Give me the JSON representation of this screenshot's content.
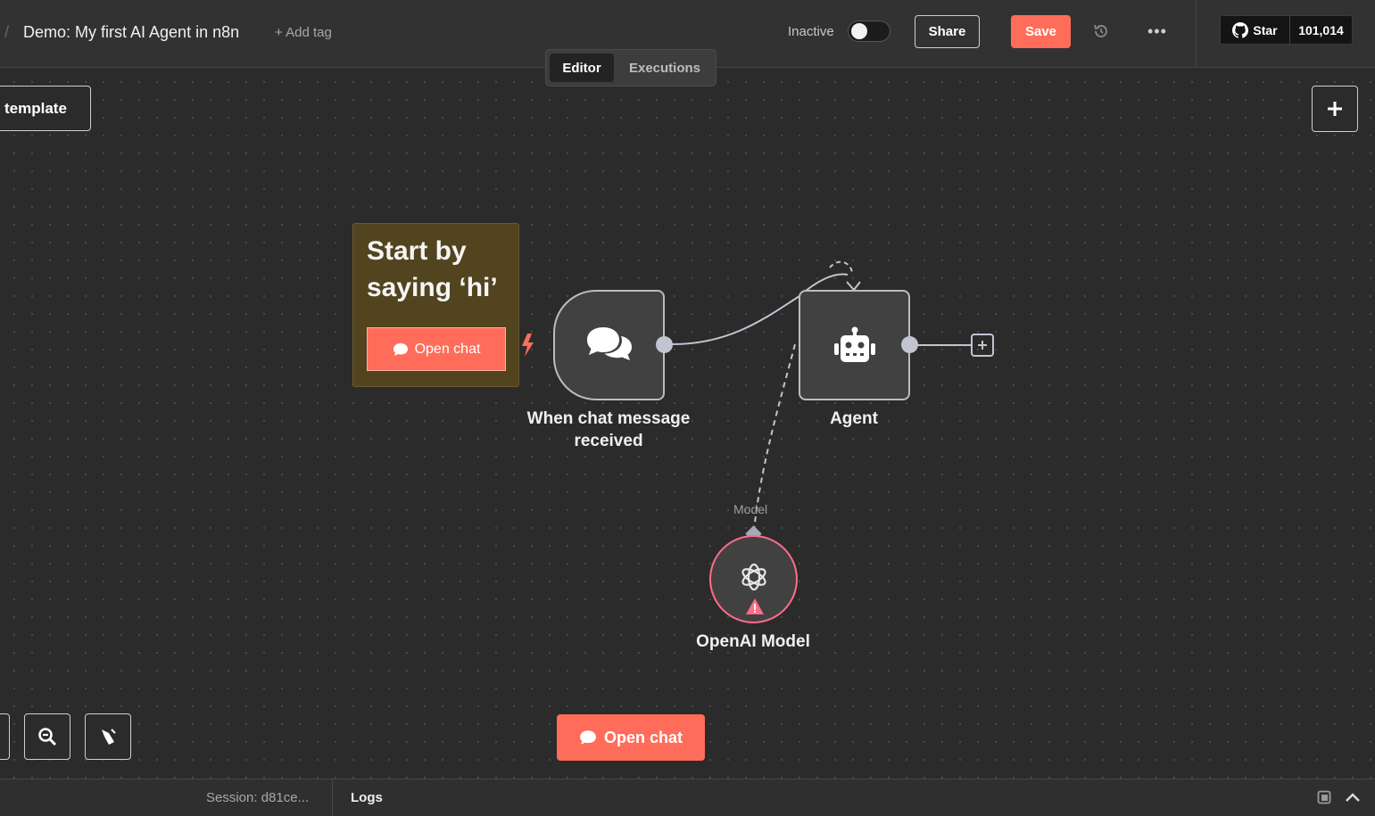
{
  "header": {
    "workflow_title": "Demo: My first AI Agent in n8n",
    "add_tag": "+ Add tag",
    "status_label": "Inactive",
    "share_label": "Share",
    "save_label": "Save",
    "github": {
      "star_label": "Star",
      "count": "101,014"
    }
  },
  "tabs": [
    {
      "label": "Editor",
      "active": true
    },
    {
      "label": "Executions",
      "active": false
    }
  ],
  "canvas": {
    "template_button": "template",
    "sticky": {
      "title_line1": "Start by",
      "title_line2": "saying ‘hi’",
      "button": "Open chat"
    },
    "nodes": {
      "trigger": {
        "label_line1": "When chat message",
        "label_line2": "received",
        "icon": "chat-bubbles-icon"
      },
      "agent": {
        "label": "Agent",
        "icon": "robot-icon"
      },
      "model": {
        "label": "OpenAI Model",
        "icon": "openai-icon",
        "warning": true
      }
    },
    "connection_label": "Model",
    "open_chat_button": "Open chat"
  },
  "footer": {
    "session": "Session: d81ce...",
    "logs": "Logs"
  },
  "colors": {
    "accent": "#ff6d5a",
    "node_border": "#bdbdbd",
    "model_border": "#ff6d8a",
    "sticky_bg": "#52441f"
  }
}
